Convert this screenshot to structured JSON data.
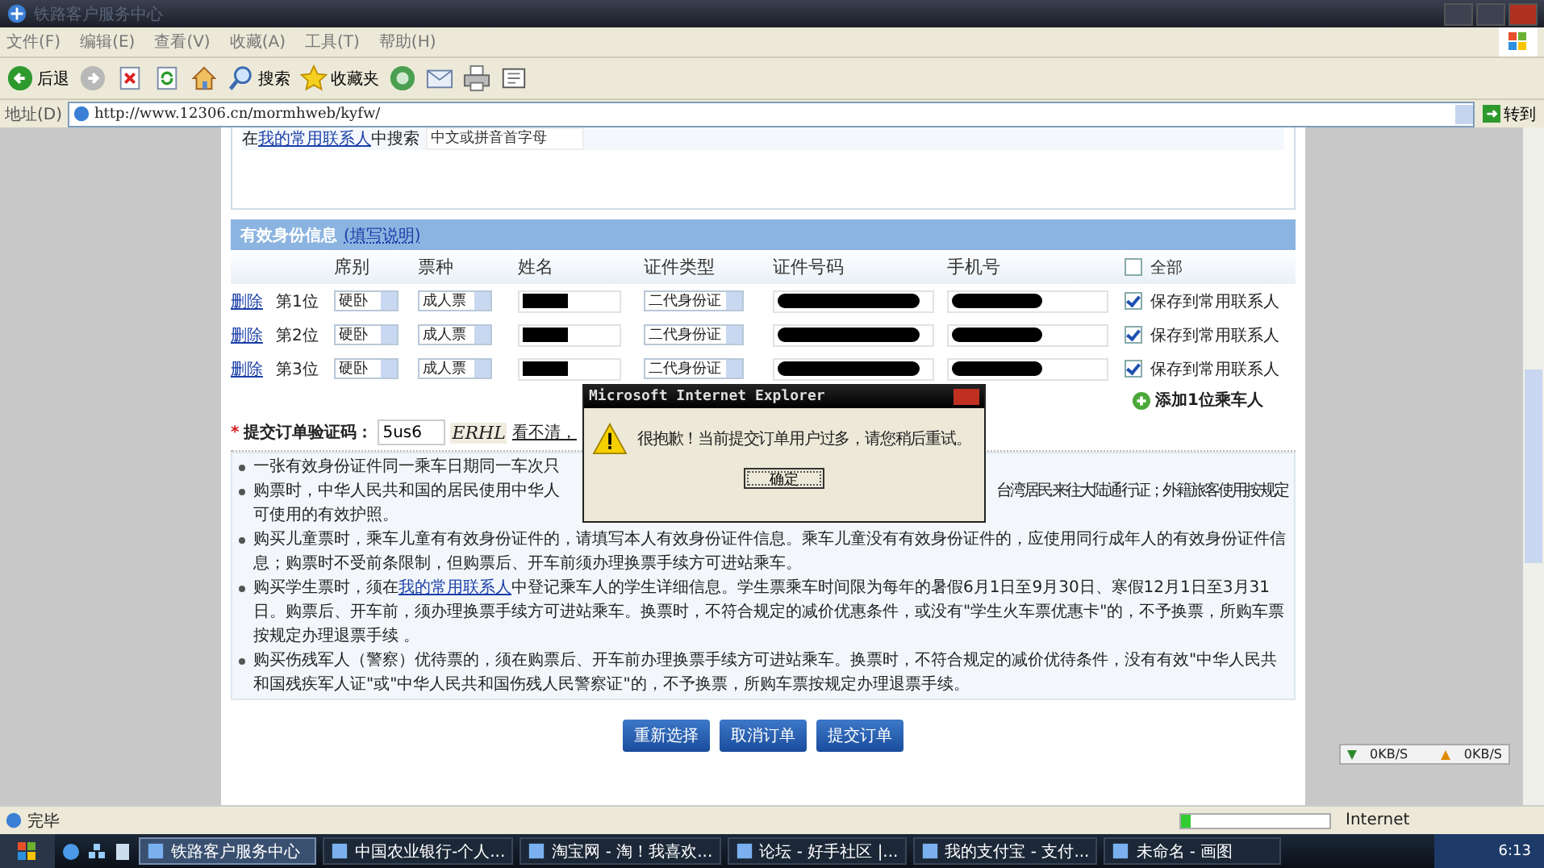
{
  "window": {
    "title": "铁路客户服务中心"
  },
  "menu": [
    "文件(F)",
    "编辑(E)",
    "查看(V)",
    "收藏(A)",
    "工具(T)",
    "帮助(H)"
  ],
  "toolbar": [
    {
      "kind": "back",
      "label": "后退"
    },
    {
      "kind": "forward"
    },
    {
      "kind": "stop"
    },
    {
      "kind": "refresh"
    },
    {
      "kind": "home"
    },
    {
      "kind": "search",
      "label": "搜索"
    },
    {
      "kind": "favorites",
      "label": "收藏夹"
    },
    {
      "kind": "media"
    },
    {
      "kind": "mail"
    },
    {
      "kind": "print"
    },
    {
      "kind": "edit"
    }
  ],
  "address": {
    "label": "地址(D)",
    "url": "http://www.12306.cn/mormhweb/kyfw/",
    "go": "转到"
  },
  "search": {
    "prefix": "在",
    "link": "我的常用联系人",
    "suffix": "中搜索",
    "placeholder": "中文或拼音首字母"
  },
  "section": {
    "title": "有效身份信息",
    "link": "(填写说明)"
  },
  "columns": [
    "席别",
    "票种",
    "姓名",
    "证件类型",
    "证件号码",
    "手机号"
  ],
  "select_all": {
    "label": "全部",
    "checked": false
  },
  "passengers": [
    {
      "delete": "删除",
      "position": "第1位",
      "seat": "硬卧",
      "ticket": "成人票",
      "id_type": "二代身份证",
      "save_label": "保存到常用联系人",
      "save_checked": true
    },
    {
      "delete": "删除",
      "position": "第2位",
      "seat": "硬卧",
      "ticket": "成人票",
      "id_type": "二代身份证",
      "save_label": "保存到常用联系人",
      "save_checked": true
    },
    {
      "delete": "删除",
      "position": "第3位",
      "seat": "硬卧",
      "ticket": "成人票",
      "id_type": "二代身份证",
      "save_label": "保存到常用联系人",
      "save_checked": true
    }
  ],
  "add_passenger": "添加1位乘车人",
  "captcha": {
    "required_mark": "*",
    "label": "提交订单验证码：",
    "value": "5us6",
    "image_text": "ERHL",
    "refresh": "看不清，"
  },
  "notes": [
    {
      "kind": "cut",
      "text": "一张有效身份证件同一乘车日期同一车次只"
    },
    {
      "kind": "split",
      "left": "购票时，中华人民共和国的居民使用中华人",
      "right": "台湾居民来往大陆通行证；外籍旅客使用按规定",
      "rest": "可使用的有效护照。"
    },
    {
      "kind": "plain",
      "text": "购买儿童票时，乘车儿童有有效身份证件的，请填写本人有效身份证件信息。乘车儿童没有有效身份证件的，应使用同行成年人的有效身份证件信息；购票时不受前条限制，但购票后、开车前须办理换票手续方可进站乘车。"
    },
    {
      "kind": "link",
      "before": "购买学生票时，须在",
      "link": "我的常用联系人",
      "after": "中登记乘车人的学生详细信息。学生票乘车时间限为每年的暑假6月1日至9月30日、寒假12月1日至3月31日。购票后、开车前，须办理换票手续方可进站乘车。换票时，不符合规定的减价优惠条件，或没有\"学生火车票优惠卡\"的，不予换票，所购车票按规定办理退票手续 。"
    },
    {
      "kind": "plain",
      "text": "购买伤残军人（警察）优待票的，须在购票后、开车前办理换票手续方可进站乘车。换票时，不符合规定的减价优待条件，没有有效\"中华人民共和国残疾军人证\"或\"中华人民共和国伤残人民警察证\"的，不予换票，所购车票按规定办理退票手续。"
    }
  ],
  "buttons": [
    "重新选择",
    "取消订单",
    "提交订单"
  ],
  "dialog": {
    "title": "Microsoft Internet Explorer",
    "message": "很抱歉！当前提交订单用户过多，请您稍后重试。",
    "ok": "确定"
  },
  "net_meter": {
    "down": "0KB/S",
    "up": "0KB/S"
  },
  "status_bar": {
    "text": "完毕",
    "progress": {
      "level": 0.06
    },
    "zone": "Internet"
  },
  "taskbar": {
    "items": [
      {
        "label": "铁路客户服务中心",
        "selected": true
      },
      {
        "label": "中国农业银行-个人...",
        "selected": false
      },
      {
        "label": "淘宝网 - 淘！我喜欢...",
        "selected": false
      },
      {
        "label": "论坛 - 好手社区 |...",
        "selected": false
      },
      {
        "label": "我的支付宝 - 支付...",
        "selected": false
      },
      {
        "label": "未命名 - 画图",
        "selected": false
      }
    ],
    "clock": "6:13"
  }
}
